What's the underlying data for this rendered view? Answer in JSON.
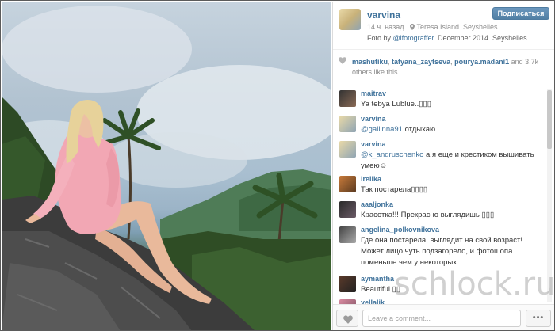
{
  "post": {
    "username": "varvina",
    "follow_label": "Подписаться",
    "time_ago": "14 ч. назад",
    "location": "Teresa Island. Seyshelles",
    "caption_prefix": "Foto by ",
    "caption_mention": "@ifotograffer",
    "caption_suffix": ". December 2014. Seyshelles."
  },
  "likes": {
    "user1": "mashutiku",
    "user2": "tatyana_zaytseva",
    "user3": "pourya.madani1",
    "and_more": " and 3.7k",
    "others": "others like this."
  },
  "comments": [
    {
      "user": "maitrav",
      "text": "Ya tebya Lublue..",
      "emoji": "▯▯▯"
    },
    {
      "user": "varvina",
      "mention": "@gallinna91",
      "text": " отдыхаю."
    },
    {
      "user": "varvina",
      "mention": "@k_andruschenko",
      "text": " а я еще и крестиком вышивать умею☺"
    },
    {
      "user": "irelika",
      "text": "Так постарела",
      "emoji": "▯▯▯▯"
    },
    {
      "user": "aaaljonka",
      "text": "Красотка!!! Прекрасно выглядишь ",
      "emoji": "▯▯▯"
    },
    {
      "user": "angelina_polkovnikova",
      "text": "Где она постарела, выглядит на свой возраст! Может лицо чуть подзагорело, и фотошопа поменьше чем у некоторых"
    },
    {
      "user": "aymantha",
      "text": "Beautiful ",
      "emoji": "▯▯"
    },
    {
      "user": "yellalik",
      "text": ""
    }
  ],
  "footer": {
    "placeholder": "Leave a comment...",
    "more_label": "•••"
  },
  "watermark": "schlock.ru",
  "colors": {
    "link": "#3f729b",
    "follow_button": "#517fa4",
    "muted": "#8e8e8e"
  }
}
